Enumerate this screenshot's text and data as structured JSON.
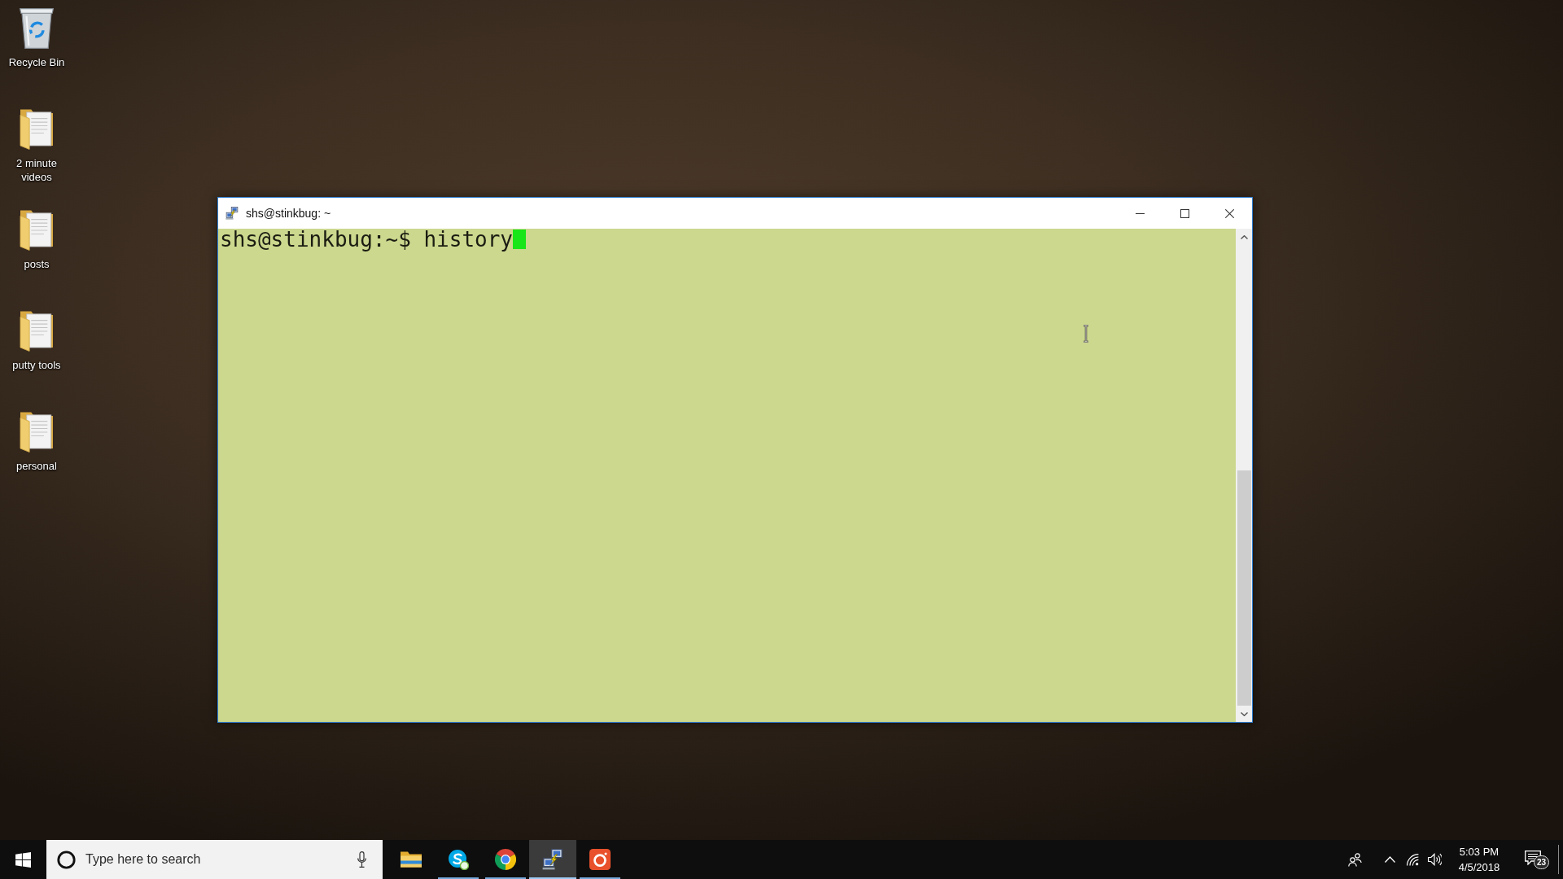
{
  "desktop": {
    "icons": [
      {
        "label": "Recycle Bin",
        "kind": "recycle-bin"
      },
      {
        "label": "2 minute videos",
        "kind": "folder"
      },
      {
        "label": "posts",
        "kind": "folder"
      },
      {
        "label": "putty tools",
        "kind": "folder"
      },
      {
        "label": "personal",
        "kind": "folder"
      }
    ]
  },
  "window": {
    "title": "shs@stinkbug: ~",
    "terminal": {
      "lines": [
        "shs@stinkbug:~$ history"
      ],
      "cursor_visible": true
    }
  },
  "taskbar": {
    "search": {
      "placeholder": "Type here to search"
    },
    "apps": [
      {
        "kind": "explorer",
        "running": false,
        "active": false
      },
      {
        "kind": "messenger",
        "running": true,
        "active": false
      },
      {
        "kind": "browser",
        "running": true,
        "active": false
      },
      {
        "kind": "ssh-client",
        "running": true,
        "active": true
      },
      {
        "kind": "camera",
        "running": true,
        "active": false
      }
    ],
    "clock": {
      "time": "5:03 PM",
      "date": "4/5/2018"
    },
    "notification_count": "23"
  }
}
